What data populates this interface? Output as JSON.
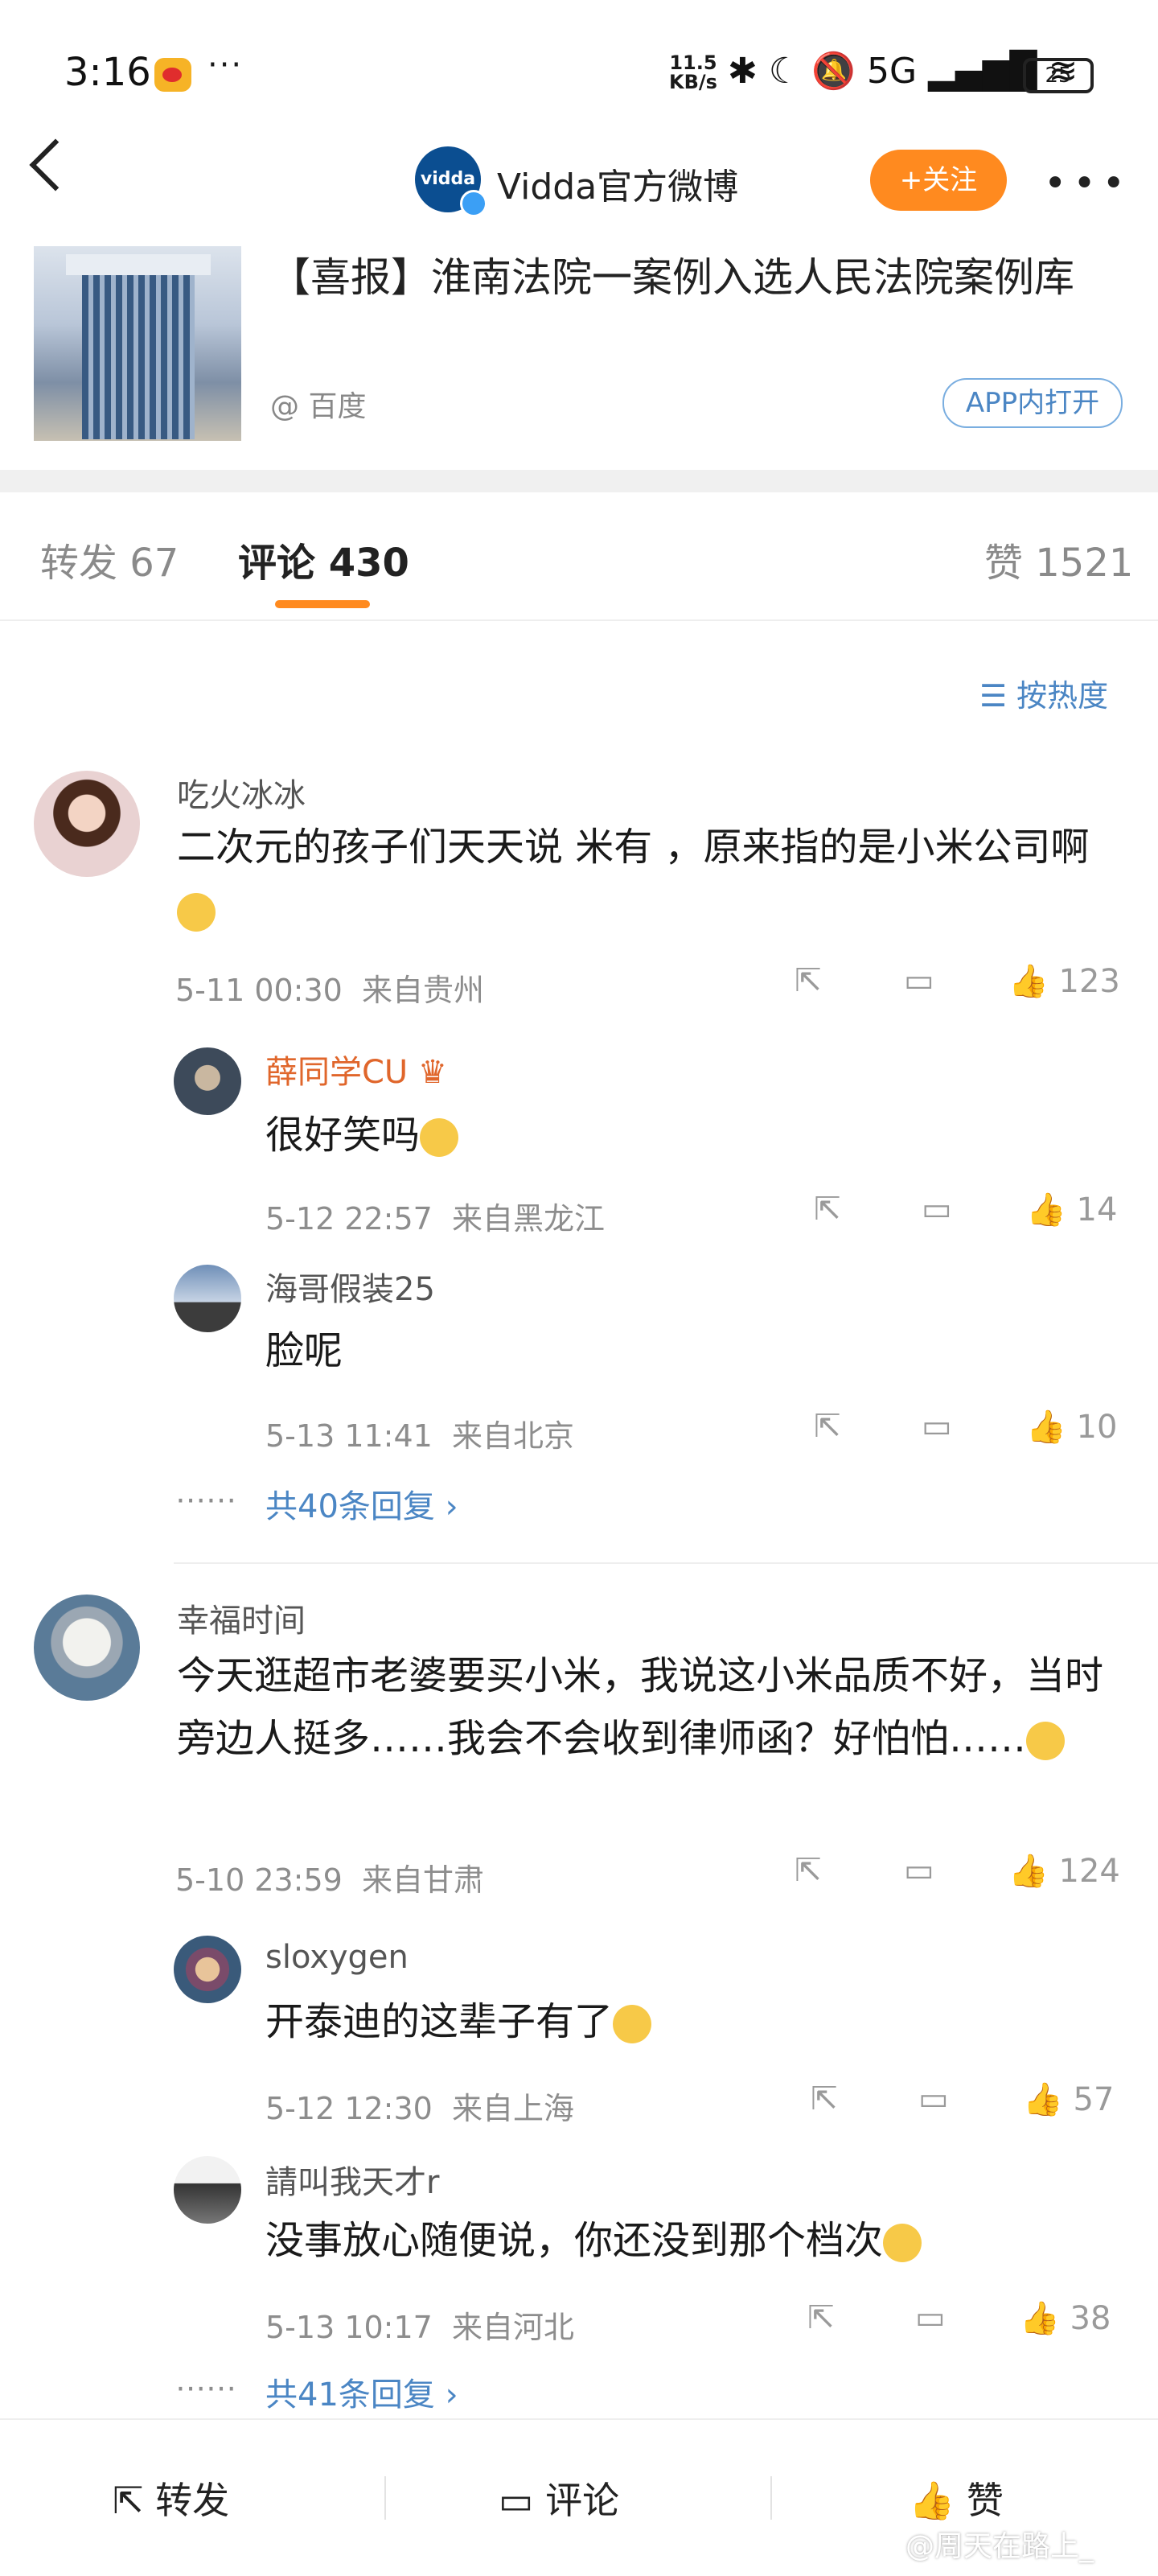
{
  "status_bar": {
    "time": "3:16",
    "more": "···",
    "net_speed_value": "11.5",
    "net_speed_unit": "KB/s",
    "icons_text": "✱ ☾ 🔕 5G ▂▄▆█ ≋",
    "battery": "25"
  },
  "header": {
    "avatar_text": "vidda",
    "title": "Vidda官方微博",
    "follow_label": "+关注",
    "more": "•••"
  },
  "article": {
    "title": "【喜报】淮南法院一案例入选人民法院案例库",
    "source": "@ 百度",
    "open_in_app": "APP内打开"
  },
  "tabs": {
    "repost": "转发 67",
    "comments": "评论 430",
    "likes": "赞 1521"
  },
  "sort_label": "按热度",
  "comments": [
    {
      "user": "吃火冰冰",
      "text": "二次元的孩子们天天说 米有 ，原来指的是小米公司啊",
      "time": "5-11 00:30",
      "location": "来自贵州",
      "likes": "123",
      "replies": [
        {
          "user": "薛同学CU",
          "text": "很好笑吗",
          "time": "5-12 22:57",
          "location": "来自黑龙江",
          "likes": "14"
        },
        {
          "user": "海哥假装25",
          "text": "脸呢",
          "time": "5-13 11:41",
          "location": "来自北京",
          "likes": "10"
        }
      ],
      "more_replies": "共40条回复 ›"
    },
    {
      "user": "幸福时间",
      "text": "今天逛超市老婆要买小米，我说这小米品质不好，当时旁边人挺多……我会不会收到律师函？好怕怕……",
      "time": "5-10 23:59",
      "location": "来自甘肃",
      "likes": "124",
      "replies": [
        {
          "user": "sloxygen",
          "text": "开泰迪的这辈子有了",
          "time": "5-12 12:30",
          "location": "来自上海",
          "likes": "57"
        },
        {
          "user": "請叫我天才r",
          "text": "没事放心随便说，你还没到那个档次",
          "time": "5-13 10:17",
          "location": "来自河北",
          "likes": "38"
        }
      ],
      "more_replies": "共41条回复 ›"
    }
  ],
  "bottom_bar": {
    "repost": "转发",
    "comment": "评论",
    "like": "赞"
  },
  "watermark": "@周天在路上_",
  "colors": {
    "accent": "#ff8a1f",
    "link": "#4b86c4",
    "vip_name": "#e0662b"
  }
}
